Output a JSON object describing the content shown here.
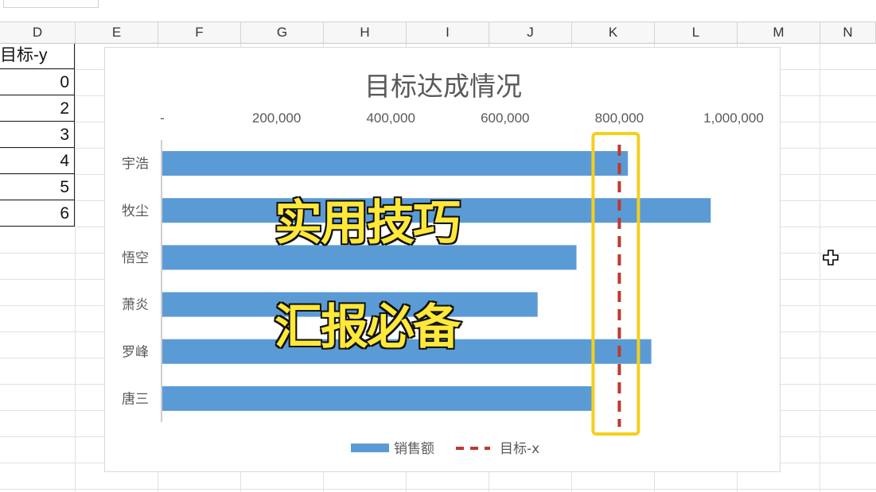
{
  "spreadsheet": {
    "name_box": "",
    "columns": [
      "D",
      "E",
      "F",
      "G",
      "H",
      "I",
      "J",
      "K",
      "L",
      "M",
      "N"
    ],
    "column_d": {
      "header": "目标-y",
      "values": [
        "0",
        "2",
        "3",
        "4",
        "5",
        "6"
      ]
    }
  },
  "chart_data": {
    "type": "bar",
    "orientation": "horizontal",
    "title": "目标达成情况",
    "categories": [
      "宇浩",
      "牧尘",
      "悟空",
      "萧炎",
      "罗峰",
      "唐三"
    ],
    "series": [
      {
        "name": "销售额",
        "type": "bar",
        "color": "#5b9bd5",
        "values": [
          815000,
          960000,
          725000,
          657000,
          856000,
          755000
        ]
      },
      {
        "name": "目标-x",
        "type": "line",
        "style": "dashed",
        "color": "#c0392b",
        "x": 800000,
        "y": [
          0,
          6
        ]
      }
    ],
    "x_ticks": [
      "-",
      "200,000",
      "400,000",
      "600,000",
      "800,000",
      "1,000,000"
    ],
    "xlim": [
      0,
      1000000
    ],
    "x_axis_position": "top",
    "legend_position": "bottom",
    "grid": false
  },
  "overlay": {
    "line1": "实用技巧",
    "line2": "汇报必备",
    "highlight_color": "#f5cf1a"
  }
}
